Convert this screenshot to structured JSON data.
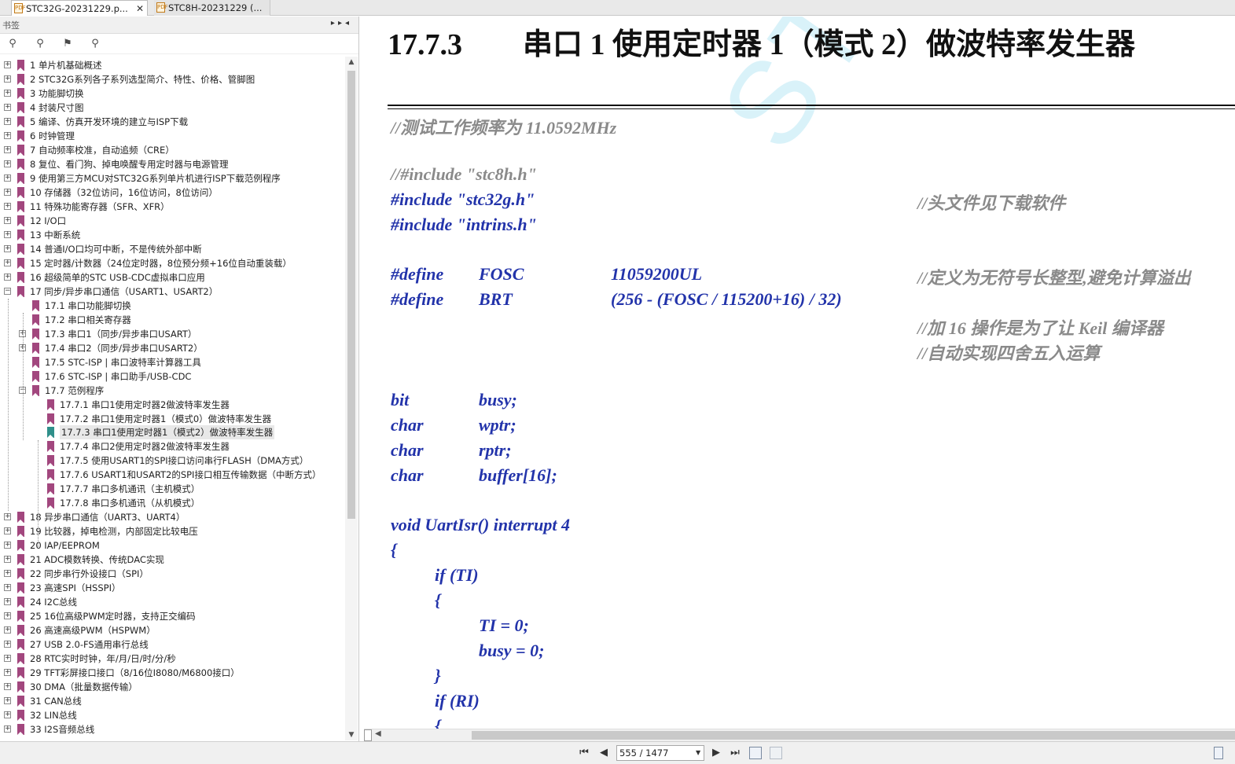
{
  "tabs": [
    {
      "label": "STC32G-20231229.p...",
      "active": true
    },
    {
      "label": "STC8H-20231229 (...",
      "active": false
    }
  ],
  "sidebar": {
    "title": "书签",
    "items": [
      {
        "label": "1 单片机基础概述",
        "level": 0,
        "expander": "plus"
      },
      {
        "label": "2  STC32G系列各子系列选型简介、特性、价格、管脚图",
        "level": 0,
        "expander": "plus"
      },
      {
        "label": "3  功能脚切换",
        "level": 0,
        "expander": "plus"
      },
      {
        "label": "4  封装尺寸图",
        "level": 0,
        "expander": "plus"
      },
      {
        "label": "5  编译、仿真开发环境的建立与ISP下载",
        "level": 0,
        "expander": "plus"
      },
      {
        "label": "6  时钟管理",
        "level": 0,
        "expander": "plus"
      },
      {
        "label": "7  自动频率校准，自动追频（CRE）",
        "level": 0,
        "expander": "plus"
      },
      {
        "label": "8  复位、看门狗、掉电唤醒专用定时器与电源管理",
        "level": 0,
        "expander": "plus"
      },
      {
        "label": "9  使用第三方MCU对STC32G系列单片机进行ISP下载范例程序",
        "level": 0,
        "expander": "plus"
      },
      {
        "label": "10  存储器（32位访问，16位访问，8位访问）",
        "level": 0,
        "expander": "plus"
      },
      {
        "label": "11  特殊功能寄存器（SFR、XFR）",
        "level": 0,
        "expander": "plus"
      },
      {
        "label": "12  I/O口",
        "level": 0,
        "expander": "plus"
      },
      {
        "label": "13  中断系统",
        "level": 0,
        "expander": "plus"
      },
      {
        "label": "14  普通I/O口均可中断，不是传统外部中断",
        "level": 0,
        "expander": "plus"
      },
      {
        "label": "15  定时器/计数器（24位定时器，8位预分频+16位自动重装载）",
        "level": 0,
        "expander": "plus"
      },
      {
        "label": "16  超级简单的STC USB-CDC虚拟串口应用",
        "level": 0,
        "expander": "plus"
      },
      {
        "label": "17  同步/异步串口通信（USART1、USART2）",
        "level": 0,
        "expander": "minus"
      },
      {
        "label": "17.1 串口功能脚切换",
        "level": 1,
        "expander": ""
      },
      {
        "label": "17.2 串口相关寄存器",
        "level": 1,
        "expander": ""
      },
      {
        "label": "17.3  串口1（同步/异步串口USART）",
        "level": 1,
        "expander": "plus"
      },
      {
        "label": "17.4  串口2（同步/异步串口USART2）",
        "level": 1,
        "expander": "plus"
      },
      {
        "label": "17.5  STC-ISP | 串口波特率计算器工具",
        "level": 1,
        "expander": ""
      },
      {
        "label": "17.6  STC-ISP | 串口助手/USB-CDC",
        "level": 1,
        "expander": ""
      },
      {
        "label": "17.7  范例程序",
        "level": 1,
        "expander": "minus"
      },
      {
        "label": "17.7.1 串口1使用定时器2做波特率发生器",
        "level": 2,
        "expander": ""
      },
      {
        "label": "17.7.2 串口1使用定时器1（模式0）做波特率发生器",
        "level": 2,
        "expander": ""
      },
      {
        "label": "17.7.3 串口1使用定时器1（模式2）做波特率发生器",
        "level": 2,
        "expander": "",
        "selected": true
      },
      {
        "label": "17.7.4 串口2使用定时器2做波特率发生器",
        "level": 2,
        "expander": ""
      },
      {
        "label": "17.7.5 使用USART1的SPI接口访问串行FLASH（DMA方式）",
        "level": 2,
        "expander": ""
      },
      {
        "label": "17.7.6 USART1和USART2的SPI接口相互传输数据（中断方式）",
        "level": 2,
        "expander": ""
      },
      {
        "label": "17.7.7  串口多机通讯（主机模式）",
        "level": 2,
        "expander": ""
      },
      {
        "label": "17.7.8 串口多机通讯（从机模式）",
        "level": 2,
        "expander": ""
      },
      {
        "label": "18  异步串口通信（UART3、UART4）",
        "level": 0,
        "expander": "plus"
      },
      {
        "label": "19  比较器，掉电检测，内部固定比较电压",
        "level": 0,
        "expander": "plus"
      },
      {
        "label": "20  IAP/EEPROM",
        "level": 0,
        "expander": "plus"
      },
      {
        "label": "21  ADC模数转换、传统DAC实现",
        "level": 0,
        "expander": "plus"
      },
      {
        "label": "22  同步串行外设接口（SPI）",
        "level": 0,
        "expander": "plus"
      },
      {
        "label": "23  高速SPI（HSSPI）",
        "level": 0,
        "expander": "plus"
      },
      {
        "label": "24  I2C总线",
        "level": 0,
        "expander": "plus"
      },
      {
        "label": "25  16位高级PWM定时器，支持正交编码",
        "level": 0,
        "expander": "plus"
      },
      {
        "label": "26  高速高级PWM（HSPWM）",
        "level": 0,
        "expander": "plus"
      },
      {
        "label": "27  USB 2.0-FS通用串行总线",
        "level": 0,
        "expander": "plus"
      },
      {
        "label": "28  RTC实时时钟，年/月/日/时/分/秒",
        "level": 0,
        "expander": "plus"
      },
      {
        "label": "29  TFT彩屏接口接口（8/16位I8080/M6800接口）",
        "level": 0,
        "expander": "plus"
      },
      {
        "label": "30  DMA（批量数据传输）",
        "level": 0,
        "expander": "plus"
      },
      {
        "label": "31  CAN总线",
        "level": 0,
        "expander": "plus"
      },
      {
        "label": "32  LIN总线",
        "level": 0,
        "expander": "plus"
      },
      {
        "label": "33  I2S音频总线",
        "level": 0,
        "expander": "plus"
      }
    ]
  },
  "document": {
    "heading_number": "17.7.3",
    "heading_title": "串口 1 使用定时器 1（模式 2）做波特率发生器",
    "watermark": "STC MCU",
    "lines": [
      {
        "text": "//测试工作频率为 11.0592MHz",
        "comment": true,
        "col": 0,
        "row": 0
      },
      {
        "text": "//#include \"stc8h.h\"",
        "comment": true,
        "col": 0,
        "row": 2
      },
      {
        "text": "#include \"stc32g.h\"",
        "comment": false,
        "col": 0,
        "row": 3
      },
      {
        "text": "//头文件见下载软件",
        "comment": true,
        "col": 3,
        "row": 3
      },
      {
        "text": "#include \"intrins.h\"",
        "comment": false,
        "col": 0,
        "row": 4
      },
      {
        "text": "#define",
        "comment": false,
        "col": 0,
        "row": 6
      },
      {
        "text": "FOSC",
        "comment": false,
        "col": 1,
        "row": 6
      },
      {
        "text": "11059200UL",
        "comment": false,
        "col": 2,
        "row": 6
      },
      {
        "text": "//定义为无符号长整型,避免计算溢出",
        "comment": true,
        "col": 3,
        "row": 6
      },
      {
        "text": "#define",
        "comment": false,
        "col": 0,
        "row": 7
      },
      {
        "text": "BRT",
        "comment": false,
        "col": 1,
        "row": 7
      },
      {
        "text": "(256 - (FOSC / 115200+16) / 32)",
        "comment": false,
        "col": 2,
        "row": 7
      },
      {
        "text": "//加 16 操作是为了让 Keil 编译器",
        "comment": true,
        "col": 3,
        "row": 8
      },
      {
        "text": "//自动实现四舍五入运算",
        "comment": true,
        "col": 3,
        "row": 9
      },
      {
        "text": "bit",
        "comment": false,
        "col": 0,
        "row": 11
      },
      {
        "text": "busy;",
        "comment": false,
        "col": 1,
        "row": 11
      },
      {
        "text": "char",
        "comment": false,
        "col": 0,
        "row": 12
      },
      {
        "text": "wptr;",
        "comment": false,
        "col": 1,
        "row": 12
      },
      {
        "text": "char",
        "comment": false,
        "col": 0,
        "row": 13
      },
      {
        "text": "rptr;",
        "comment": false,
        "col": 1,
        "row": 13
      },
      {
        "text": "char",
        "comment": false,
        "col": 0,
        "row": 14
      },
      {
        "text": "buffer[16];",
        "comment": false,
        "col": 1,
        "row": 14
      },
      {
        "text": "void UartIsr() interrupt 4",
        "comment": false,
        "col": 0,
        "row": 16
      },
      {
        "text": "{",
        "comment": false,
        "col": 0,
        "row": 17
      },
      {
        "text": "if (TI)",
        "comment": false,
        "col": 4,
        "row": 18
      },
      {
        "text": "{",
        "comment": false,
        "col": 4,
        "row": 19
      },
      {
        "text": "TI = 0;",
        "comment": false,
        "col": 1,
        "row": 20
      },
      {
        "text": "busy = 0;",
        "comment": false,
        "col": 1,
        "row": 21
      },
      {
        "text": "}",
        "comment": false,
        "col": 4,
        "row": 22
      },
      {
        "text": "if (RI)",
        "comment": false,
        "col": 4,
        "row": 23
      },
      {
        "text": "{",
        "comment": false,
        "col": 4,
        "row": 24
      }
    ]
  },
  "navigation": {
    "page_display": "555 / 1477"
  },
  "icons": {
    "first": "first-page-icon",
    "prev": "prev-page-icon",
    "next": "next-page-icon",
    "last": "last-page-icon"
  }
}
